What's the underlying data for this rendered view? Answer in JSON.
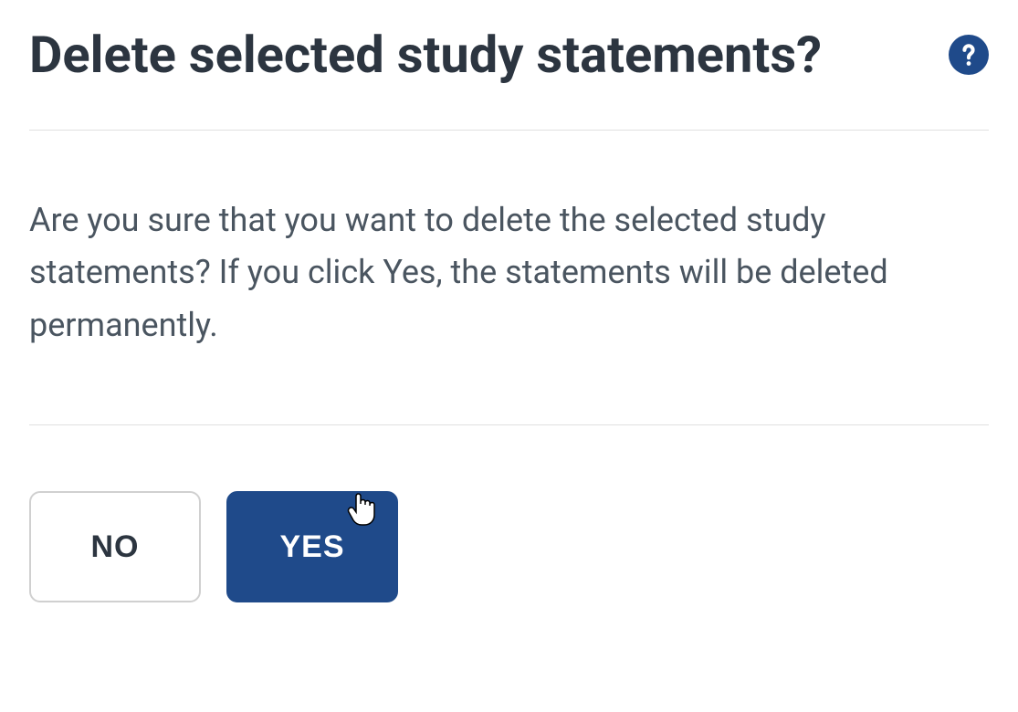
{
  "dialog": {
    "title": "Delete selected study statements?",
    "message": "Are you sure that you want to delete the selected study statements? If you click Yes, the statements will be deleted permanently.",
    "no_label": "NO",
    "yes_label": "YES"
  }
}
